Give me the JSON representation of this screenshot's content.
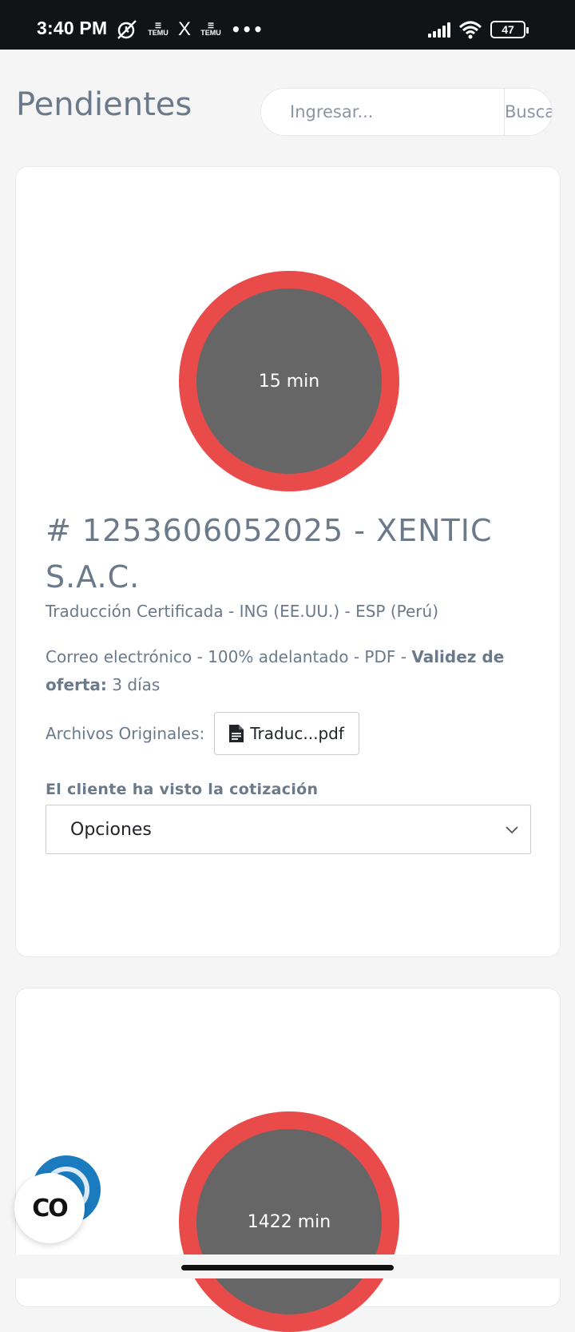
{
  "status_bar": {
    "time": "3:40 PM",
    "temu_label_1": "TEMU",
    "temu_label_2": "TEMU",
    "x_label": "X",
    "more_label": "•••",
    "battery": "47"
  },
  "header": {
    "title": "Pendientes",
    "search_placeholder": "Ingresar...",
    "search_button": "Buscar"
  },
  "quotes": [
    {
      "timer": "15 min",
      "title": "# 1253606052025 - XENTIC S.A.C.",
      "service": "Traducción Certificada - ING (EE.UU.) - ESP (Perú)",
      "terms_prefix": "Correo electrónico - 100% adelantado - PDF - ",
      "validity_label": "Validez de oferta:",
      "validity_value": " 3 días",
      "files_label": "Archivos Originales:",
      "file_name": "Traduc...pdf",
      "seen_label": "El cliente ha visto la cotización",
      "select_value": "Opciones"
    },
    {
      "timer": "1422 min"
    }
  ],
  "fab": {
    "label": "CO"
  },
  "colors": {
    "timer_ring": "#e94b4b",
    "timer_inner": "#666666",
    "text_muted": "#6b7a8b",
    "fab_blue": "#1a7bbf"
  }
}
